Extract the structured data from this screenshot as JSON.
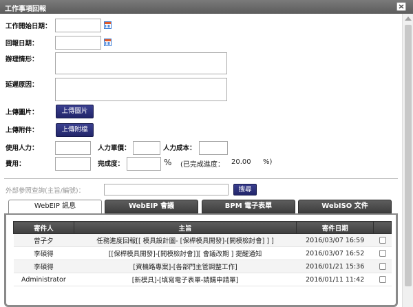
{
  "window": {
    "title": "工作事項回報"
  },
  "form": {
    "start_date_label": "工作開始日期：",
    "report_date_label": "回報日期：",
    "status_label": "辦理情形：",
    "delay_label": "延遲原因：",
    "upload_image_label": "上傳圖片：",
    "upload_image_button": "上傳圖片",
    "upload_attach_label": "上傳附件：",
    "upload_attach_button": "上傳附檔",
    "manpower_label": "使用人力：",
    "unit_price_label": "人力單價：",
    "cost_label": "人力成本：",
    "expense_label": "費用：",
    "completion_label": "完成度：",
    "percent_sign": "%",
    "completed_text": "(已完成進度：",
    "completed_value": "20.00",
    "completed_suffix": "%)"
  },
  "external": {
    "label": "外部參照查詢(主旨/編號)：",
    "search_button": "搜尋",
    "search_value": ""
  },
  "tabs": [
    {
      "label": "WebEIP 訊息",
      "active": true
    },
    {
      "label": "WebEIP 會議",
      "active": false
    },
    {
      "label": "BPM 電子表單",
      "active": false
    },
    {
      "label": "WebISO 文件",
      "active": false
    }
  ],
  "table": {
    "headers": {
      "sender": "寄件人",
      "subject": "主旨",
      "date": "寄件日期"
    },
    "rows": [
      {
        "sender": "曾子夕",
        "subject": "任務進度回報[[ 模具設計圖- [保桿模具開發]-[開模檢討會] ] ]",
        "date": "2016/03/07 16:59"
      },
      {
        "sender": "李碩得",
        "subject": "[[保桿模具開發]-[開模檢討會]][ 會議改期 ] 提醒通知",
        "date": "2016/03/07 16:52"
      },
      {
        "sender": "李碩得",
        "subject": "[資機路專案]-[各部門主管調整工作]",
        "date": "2016/01/21 15:36"
      },
      {
        "sender": "Administrator",
        "subject": "[新模具]-[填寫電子表單-請購申請單]",
        "date": "2016/01/11 11:42"
      }
    ]
  },
  "colors": {
    "titlebar": "#666666",
    "button_dark": "#2a2e78",
    "tab_inactive": "#4a4a4a"
  },
  "icons": {
    "close": "close-icon",
    "calendar": "calendar-icon"
  }
}
